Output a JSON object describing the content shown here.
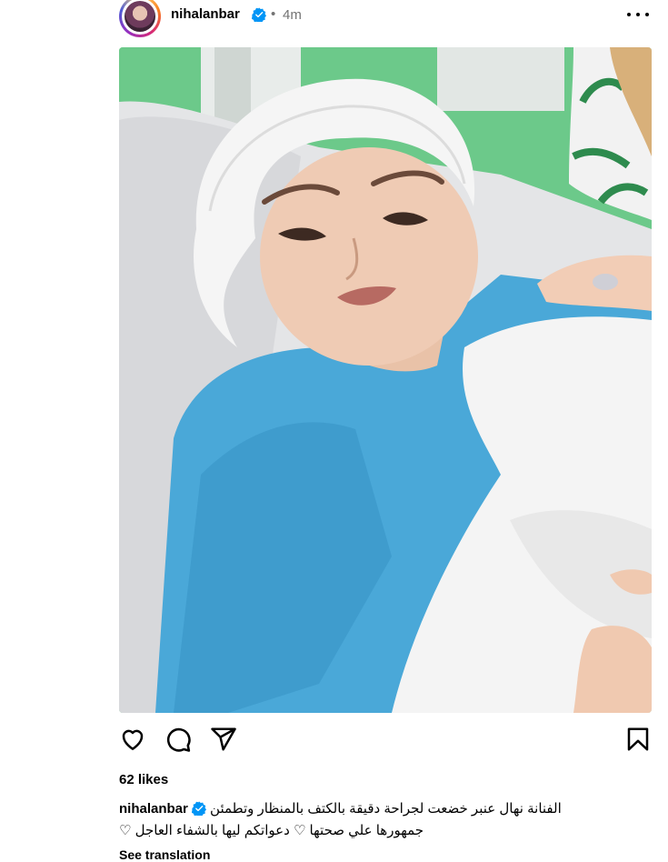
{
  "post": {
    "username": "nihalanbar",
    "time": "4m",
    "separator": "•",
    "likes": "62 likes",
    "caption_line1": "الفنانة نهال عنبر خضعت لجراحة دقيقة بالكتف بالمنظار وتطمئن",
    "caption_line2": "جمهورها علي صحتها ♡ دعواتكم ليها بالشفاء العاجل ♡",
    "see_translation": "See translation"
  },
  "icons": {
    "verified": "verified-badge-icon",
    "more": "more-options-icon",
    "like": "heart-icon",
    "comment": "comment-icon",
    "share": "share-icon",
    "save": "bookmark-icon"
  },
  "colors": {
    "verified": "#0095f6",
    "secondary_text": "#737373"
  }
}
